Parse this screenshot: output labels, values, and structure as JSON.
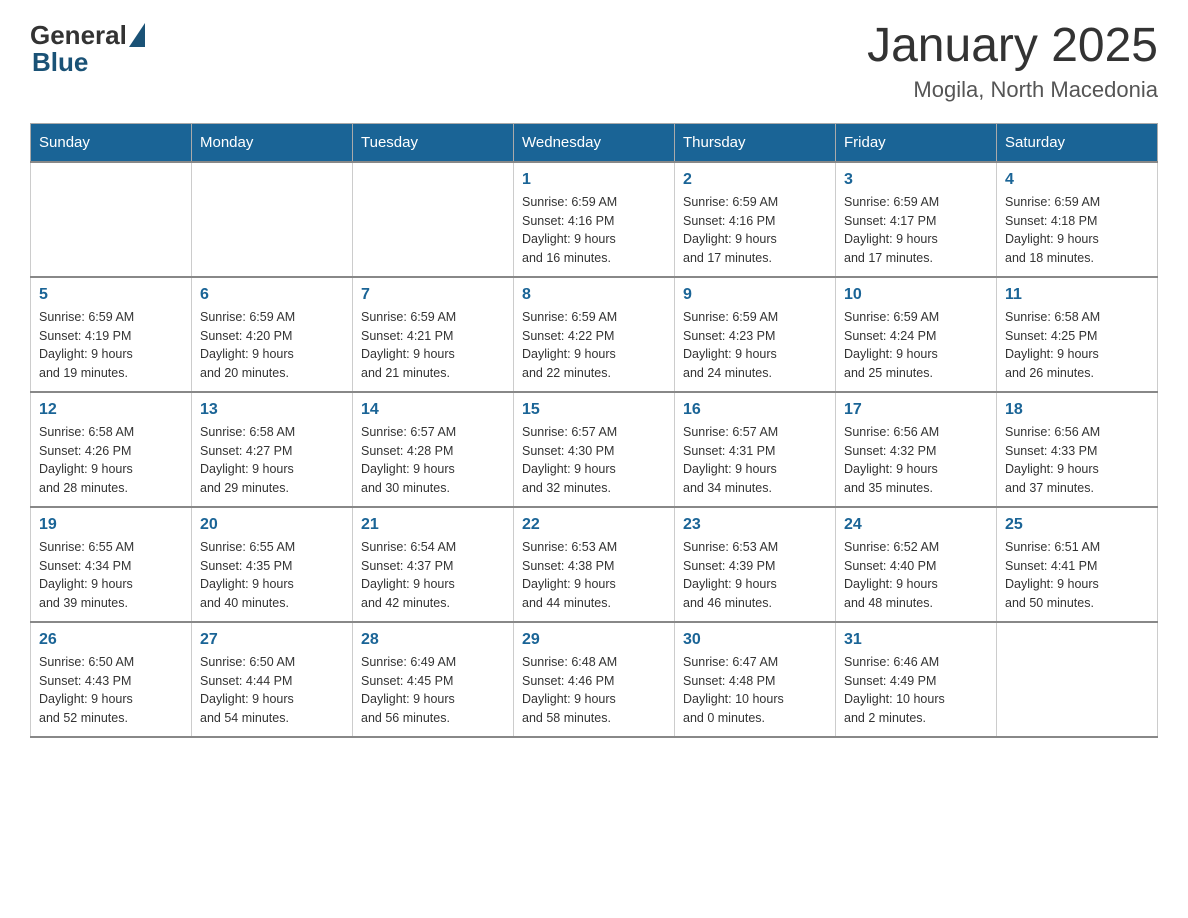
{
  "logo": {
    "general": "General",
    "blue": "Blue"
  },
  "title": "January 2025",
  "subtitle": "Mogila, North Macedonia",
  "days_of_week": [
    "Sunday",
    "Monday",
    "Tuesday",
    "Wednesday",
    "Thursday",
    "Friday",
    "Saturday"
  ],
  "weeks": [
    [
      {
        "day": "",
        "info": ""
      },
      {
        "day": "",
        "info": ""
      },
      {
        "day": "",
        "info": ""
      },
      {
        "day": "1",
        "info": "Sunrise: 6:59 AM\nSunset: 4:16 PM\nDaylight: 9 hours\nand 16 minutes."
      },
      {
        "day": "2",
        "info": "Sunrise: 6:59 AM\nSunset: 4:16 PM\nDaylight: 9 hours\nand 17 minutes."
      },
      {
        "day": "3",
        "info": "Sunrise: 6:59 AM\nSunset: 4:17 PM\nDaylight: 9 hours\nand 17 minutes."
      },
      {
        "day": "4",
        "info": "Sunrise: 6:59 AM\nSunset: 4:18 PM\nDaylight: 9 hours\nand 18 minutes."
      }
    ],
    [
      {
        "day": "5",
        "info": "Sunrise: 6:59 AM\nSunset: 4:19 PM\nDaylight: 9 hours\nand 19 minutes."
      },
      {
        "day": "6",
        "info": "Sunrise: 6:59 AM\nSunset: 4:20 PM\nDaylight: 9 hours\nand 20 minutes."
      },
      {
        "day": "7",
        "info": "Sunrise: 6:59 AM\nSunset: 4:21 PM\nDaylight: 9 hours\nand 21 minutes."
      },
      {
        "day": "8",
        "info": "Sunrise: 6:59 AM\nSunset: 4:22 PM\nDaylight: 9 hours\nand 22 minutes."
      },
      {
        "day": "9",
        "info": "Sunrise: 6:59 AM\nSunset: 4:23 PM\nDaylight: 9 hours\nand 24 minutes."
      },
      {
        "day": "10",
        "info": "Sunrise: 6:59 AM\nSunset: 4:24 PM\nDaylight: 9 hours\nand 25 minutes."
      },
      {
        "day": "11",
        "info": "Sunrise: 6:58 AM\nSunset: 4:25 PM\nDaylight: 9 hours\nand 26 minutes."
      }
    ],
    [
      {
        "day": "12",
        "info": "Sunrise: 6:58 AM\nSunset: 4:26 PM\nDaylight: 9 hours\nand 28 minutes."
      },
      {
        "day": "13",
        "info": "Sunrise: 6:58 AM\nSunset: 4:27 PM\nDaylight: 9 hours\nand 29 minutes."
      },
      {
        "day": "14",
        "info": "Sunrise: 6:57 AM\nSunset: 4:28 PM\nDaylight: 9 hours\nand 30 minutes."
      },
      {
        "day": "15",
        "info": "Sunrise: 6:57 AM\nSunset: 4:30 PM\nDaylight: 9 hours\nand 32 minutes."
      },
      {
        "day": "16",
        "info": "Sunrise: 6:57 AM\nSunset: 4:31 PM\nDaylight: 9 hours\nand 34 minutes."
      },
      {
        "day": "17",
        "info": "Sunrise: 6:56 AM\nSunset: 4:32 PM\nDaylight: 9 hours\nand 35 minutes."
      },
      {
        "day": "18",
        "info": "Sunrise: 6:56 AM\nSunset: 4:33 PM\nDaylight: 9 hours\nand 37 minutes."
      }
    ],
    [
      {
        "day": "19",
        "info": "Sunrise: 6:55 AM\nSunset: 4:34 PM\nDaylight: 9 hours\nand 39 minutes."
      },
      {
        "day": "20",
        "info": "Sunrise: 6:55 AM\nSunset: 4:35 PM\nDaylight: 9 hours\nand 40 minutes."
      },
      {
        "day": "21",
        "info": "Sunrise: 6:54 AM\nSunset: 4:37 PM\nDaylight: 9 hours\nand 42 minutes."
      },
      {
        "day": "22",
        "info": "Sunrise: 6:53 AM\nSunset: 4:38 PM\nDaylight: 9 hours\nand 44 minutes."
      },
      {
        "day": "23",
        "info": "Sunrise: 6:53 AM\nSunset: 4:39 PM\nDaylight: 9 hours\nand 46 minutes."
      },
      {
        "day": "24",
        "info": "Sunrise: 6:52 AM\nSunset: 4:40 PM\nDaylight: 9 hours\nand 48 minutes."
      },
      {
        "day": "25",
        "info": "Sunrise: 6:51 AM\nSunset: 4:41 PM\nDaylight: 9 hours\nand 50 minutes."
      }
    ],
    [
      {
        "day": "26",
        "info": "Sunrise: 6:50 AM\nSunset: 4:43 PM\nDaylight: 9 hours\nand 52 minutes."
      },
      {
        "day": "27",
        "info": "Sunrise: 6:50 AM\nSunset: 4:44 PM\nDaylight: 9 hours\nand 54 minutes."
      },
      {
        "day": "28",
        "info": "Sunrise: 6:49 AM\nSunset: 4:45 PM\nDaylight: 9 hours\nand 56 minutes."
      },
      {
        "day": "29",
        "info": "Sunrise: 6:48 AM\nSunset: 4:46 PM\nDaylight: 9 hours\nand 58 minutes."
      },
      {
        "day": "30",
        "info": "Sunrise: 6:47 AM\nSunset: 4:48 PM\nDaylight: 10 hours\nand 0 minutes."
      },
      {
        "day": "31",
        "info": "Sunrise: 6:46 AM\nSunset: 4:49 PM\nDaylight: 10 hours\nand 2 minutes."
      },
      {
        "day": "",
        "info": ""
      }
    ]
  ]
}
